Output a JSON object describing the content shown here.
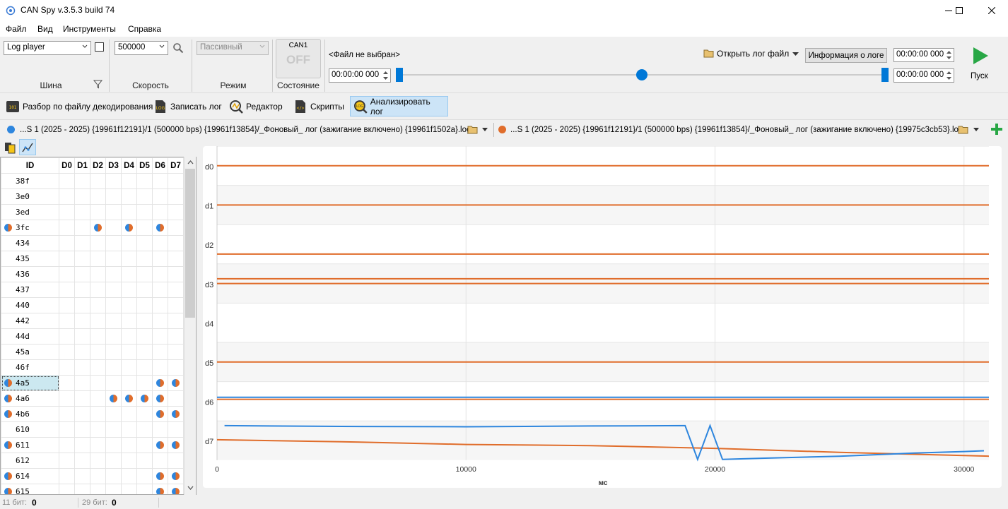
{
  "window": {
    "title": "CAN Spy v.3.5.3 build 74",
    "controls": [
      "minimize-icon",
      "maximize-icon",
      "close-icon"
    ]
  },
  "menu": [
    "Файл",
    "Вид",
    "Инструменты",
    "Справка"
  ],
  "toolbar": {
    "bus_select": "Log player",
    "bus_label": "Шина",
    "speed_select": "500000",
    "speed_label": "Скорость",
    "mode_select": "Пассивный",
    "mode_label": "Режим",
    "state_channel": "CAN1",
    "state_value": "OFF",
    "state_label": "Состояние",
    "file_status": "<Файл не выбран>",
    "open_log": "Открыть лог файл",
    "log_info": "Информация о логе",
    "time_start": "00:00:00  000",
    "time_end_top": "00:00:00 000",
    "time_end_bottom": "00:00:00 000",
    "play_label": "Пуск",
    "timeline_marker": 0.5
  },
  "ribbon": [
    {
      "label": "Разбор по файлу декодирования",
      "icon": "decode-file-icon"
    },
    {
      "label": "Записать лог",
      "icon": "record-log-icon"
    },
    {
      "label": "Редактор",
      "icon": "editor-icon"
    },
    {
      "label": "Скрипты",
      "icon": "scripts-icon"
    },
    {
      "label": "Анализировать лог",
      "icon": "analyze-log-icon"
    }
  ],
  "files": [
    {
      "color": "#2e86de",
      "name": "...S 1 (2025 - 2025) {19961f12191}/1 (500000 bps) {19961f13854}/_Фоновый_ лог (зажигание включено) {19961f1502a}.log"
    },
    {
      "color": "#e06d2b",
      "name": "...S 1 (2025 - 2025) {19961f12191}/1 (500000 bps) {19961f13854}/_Фоновый_ лог (зажигание включено) {19975c3cb53}.log"
    }
  ],
  "table": {
    "headers": [
      "ID",
      "D0",
      "D1",
      "D2",
      "D3",
      "D4",
      "D5",
      "D6",
      "D7"
    ],
    "rows": [
      {
        "id": "38f",
        "mark": false,
        "d": []
      },
      {
        "id": "3e0",
        "mark": false,
        "d": []
      },
      {
        "id": "3ed",
        "mark": false,
        "d": []
      },
      {
        "id": "3fc",
        "mark": true,
        "d": [
          2,
          4,
          6
        ]
      },
      {
        "id": "434",
        "mark": false,
        "d": []
      },
      {
        "id": "435",
        "mark": false,
        "d": []
      },
      {
        "id": "436",
        "mark": false,
        "d": []
      },
      {
        "id": "437",
        "mark": false,
        "d": []
      },
      {
        "id": "440",
        "mark": false,
        "d": []
      },
      {
        "id": "442",
        "mark": false,
        "d": []
      },
      {
        "id": "44d",
        "mark": false,
        "d": []
      },
      {
        "id": "45a",
        "mark": false,
        "d": []
      },
      {
        "id": "46f",
        "mark": false,
        "d": []
      },
      {
        "id": "4a5",
        "mark": true,
        "d": [
          6,
          7
        ],
        "selected": true
      },
      {
        "id": "4a6",
        "mark": true,
        "d": [
          3,
          4,
          5,
          6
        ]
      },
      {
        "id": "4b6",
        "mark": true,
        "d": [
          6,
          7
        ]
      },
      {
        "id": "610",
        "mark": false,
        "d": []
      },
      {
        "id": "611",
        "mark": true,
        "d": [
          6,
          7
        ]
      },
      {
        "id": "612",
        "mark": false,
        "d": []
      },
      {
        "id": "614",
        "mark": true,
        "d": [
          6,
          7
        ]
      },
      {
        "id": "615",
        "mark": true,
        "d": [
          6,
          7
        ]
      }
    ]
  },
  "status": {
    "bits11_label": "11 бит:",
    "bits11_value": "0",
    "bits29_label": "29 бит:",
    "bits29_value": "0"
  },
  "chart_data": {
    "type": "line",
    "xlabel": "мс",
    "ylabel": "",
    "rows": [
      "d0",
      "d1",
      "d2",
      "d3",
      "d4",
      "d5",
      "d6",
      "d7"
    ],
    "x_ticks": [
      0,
      10000,
      20000,
      30000
    ],
    "xlim": [
      0,
      31000
    ],
    "series": [
      {
        "color": "#e06d2b",
        "segments": [
          {
            "row": "d0",
            "points": [
              [
                0,
                0.5
              ],
              [
                31000,
                0.5
              ]
            ]
          },
          {
            "row": "d1",
            "points": [
              [
                0,
                0.5
              ],
              [
                31000,
                0.5
              ]
            ]
          },
          {
            "row": "d2",
            "points": [
              [
                0,
                0.25
              ],
              [
                31000,
                0.25
              ]
            ]
          },
          {
            "row": "d3",
            "points": [
              [
                0,
                0.5
              ],
              [
                31000,
                0.5
              ]
            ]
          },
          {
            "row": "d3",
            "points": [
              [
                0,
                0.62
              ],
              [
                31000,
                0.62
              ]
            ]
          },
          {
            "row": "d5",
            "points": [
              [
                0,
                0.5
              ],
              [
                31000,
                0.5
              ]
            ]
          },
          {
            "row": "d6",
            "points": [
              [
                0,
                0.55
              ],
              [
                31000,
                0.55
              ]
            ]
          },
          {
            "row": "d7",
            "points": [
              [
                0,
                0.52
              ],
              [
                5000,
                0.47
              ],
              [
                10000,
                0.4
              ],
              [
                15000,
                0.37
              ],
              [
                20000,
                0.3
              ],
              [
                25000,
                0.2
              ],
              [
                31000,
                0.1
              ]
            ]
          }
        ]
      },
      {
        "color": "#2e86de",
        "segments": [
          {
            "row": "d6",
            "points": [
              [
                0,
                0.6
              ],
              [
                31000,
                0.6
              ]
            ]
          },
          {
            "row": "d7",
            "points": [
              [
                300,
                0.88
              ],
              [
                5000,
                0.86
              ],
              [
                10000,
                0.85
              ],
              [
                15000,
                0.87
              ],
              [
                18800,
                0.88
              ],
              [
                19300,
                0.02
              ],
              [
                19800,
                0.88
              ],
              [
                20300,
                0.02
              ],
              [
                22000,
                0.05
              ],
              [
                25000,
                0.1
              ],
              [
                28000,
                0.18
              ],
              [
                30000,
                0.22
              ],
              [
                30800,
                0.24
              ]
            ]
          }
        ]
      }
    ]
  }
}
